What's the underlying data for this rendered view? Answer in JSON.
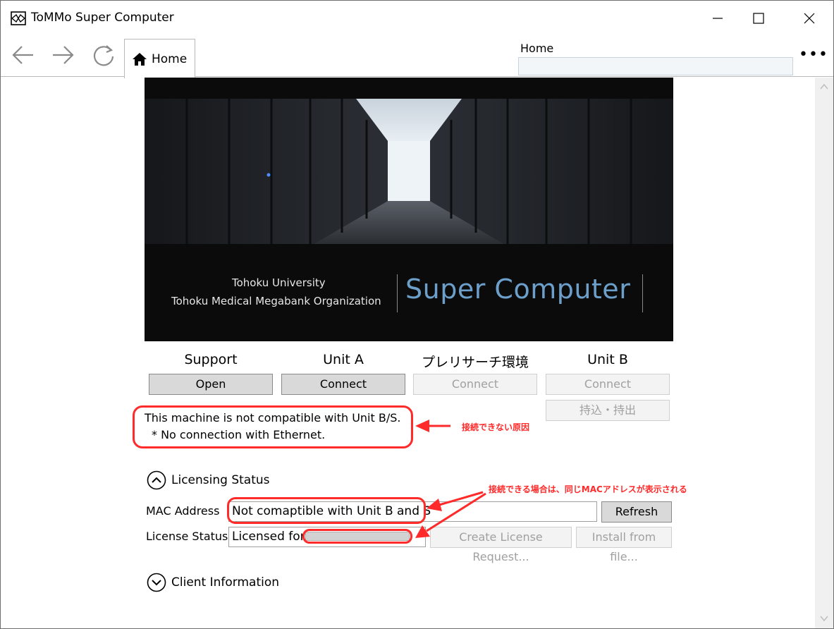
{
  "window": {
    "title": "ToMMo Super Computer"
  },
  "nav": {
    "tab_label": "Home",
    "header_caption": "Home",
    "address_value": ""
  },
  "banner": {
    "line1": "Tohoku University",
    "line2": "Tohoku Medical Megabank Organization",
    "title": "Super Computer"
  },
  "columns": [
    {
      "label": "Support",
      "button": "Open",
      "enabled": true
    },
    {
      "label": "Unit A",
      "button": "Connect",
      "enabled": true
    },
    {
      "label": "プレリサーチ環境",
      "button": "Connect",
      "enabled": false
    },
    {
      "label": "Unit B",
      "button": "Connect",
      "enabled": false,
      "extra_button": "持込・持出"
    }
  ],
  "warning": {
    "line1": "This machine is not compatible with Unit B/S.",
    "line2": "* No connection with Ethernet."
  },
  "annotations": {
    "reason": "接続できない原因",
    "mac_note": "接続できる場合は、同じMACアドレスが表示される"
  },
  "licensing": {
    "section_label": "Licensing Status",
    "mac_label": "MAC Address",
    "mac_value": "Not comaptible with Unit B and S",
    "refresh_button": "Refresh",
    "license_label": "License Status",
    "license_value": "Licensed for",
    "create_request_button": "Create License Request...",
    "install_button": "Install from file..."
  },
  "client": {
    "section_label": "Client Information"
  },
  "colors": {
    "annotation_red": "#ff2a2a",
    "banner_title_blue": "#6d9fcb"
  }
}
